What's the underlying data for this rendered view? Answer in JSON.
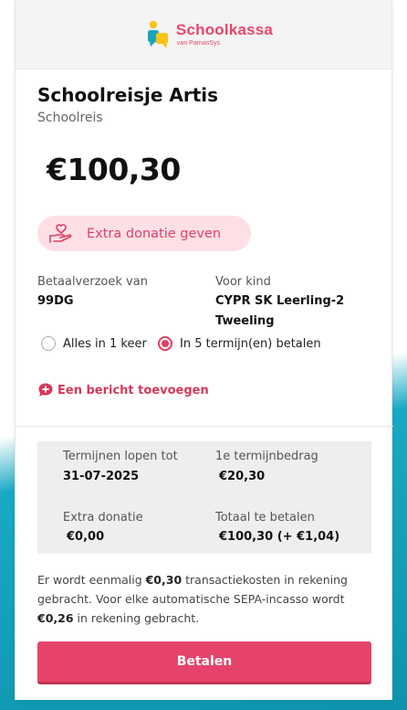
{
  "brand": {
    "name": "Schoolkassa",
    "sub": "van ParnasSys",
    "colors": {
      "accent": "#e5436a",
      "teal": "#19a9c4",
      "logo_yellow": "#f7c31a",
      "logo_teal": "#1aa6b8"
    }
  },
  "payment": {
    "title": "Schoolreisje Artis",
    "category": "Schoolreis",
    "amount": "€100,30"
  },
  "donate": {
    "label": "Extra donatie geven",
    "icon": "hand-heart-icon"
  },
  "request": {
    "from_label": "Betaalverzoek van",
    "from_value": "99DG",
    "child_label": "Voor kind",
    "child_value_line1": "CYPR SK Leerling-2",
    "child_value_line2": "Tweeling"
  },
  "options": {
    "once_label": "Alles in 1 keer",
    "installments_label": "In 5 termijn(en) betalen",
    "selected": "installments"
  },
  "message": {
    "label": "Een bericht toevoegen",
    "icon": "chat-plus-icon"
  },
  "summary": {
    "term_end_label": "Termijnen lopen tot",
    "term_end_value": "31-07-2025",
    "first_term_label": "1e termijnbedrag",
    "first_term_value": "€20,30",
    "donation_label": "Extra donatie",
    "donation_value": "€0,00",
    "total_label": "Totaal te betalen",
    "total_value": "€100,30 (+ €1,04)"
  },
  "info": {
    "p1": "Er wordt eenmalig ",
    "fee_once": "€0,30",
    "p2": " transactiekosten in rekening gebracht. Voor elke automatische SEPA-incasso wordt ",
    "fee_each": "€0,26",
    "p3": " in rekening gebracht."
  },
  "pay_button": {
    "label": "Betalen"
  }
}
